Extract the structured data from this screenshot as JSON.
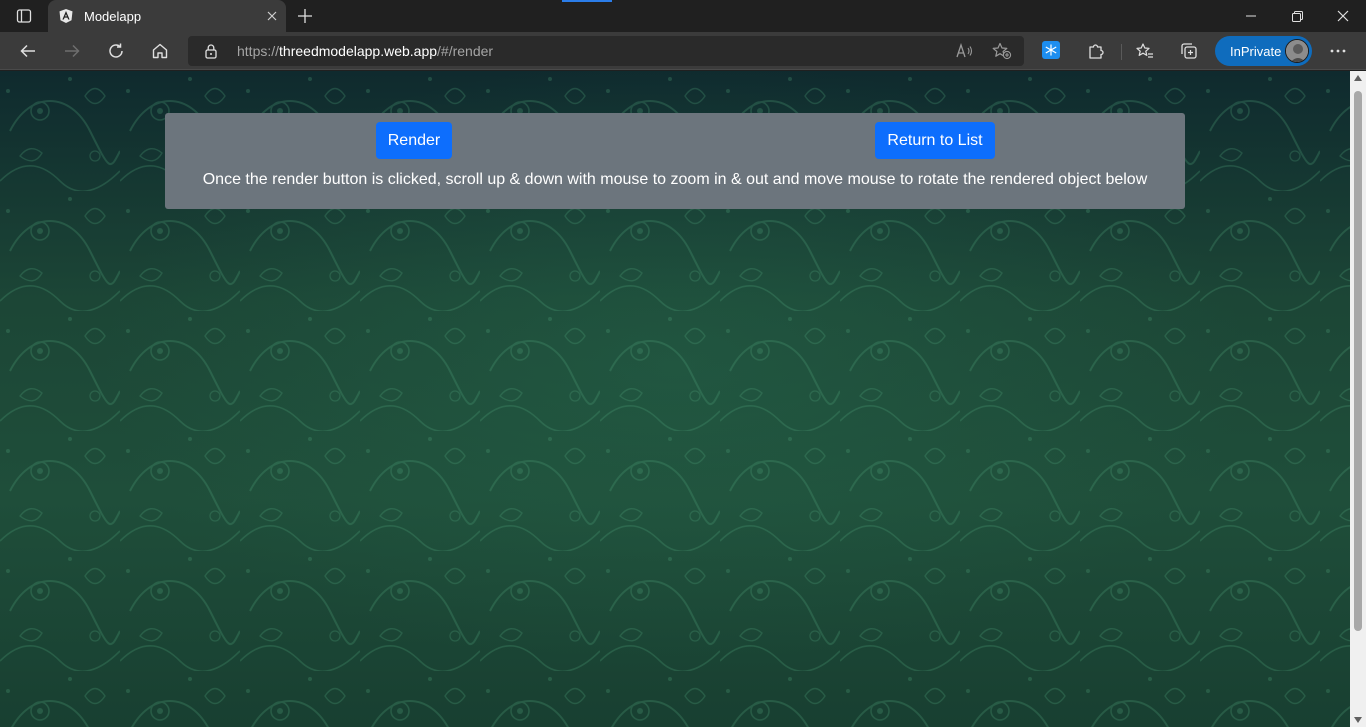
{
  "browser": {
    "tab": {
      "title": "Modelapp",
      "favicon": "angular-icon"
    },
    "address": {
      "scheme": "https://",
      "host": "threedmodelapp.web.app",
      "path": "/#/render"
    },
    "profile": {
      "label": "InPrivate"
    },
    "accent_color": "#0f6cbd"
  },
  "page": {
    "render_button": "Render",
    "return_button": "Return to List",
    "instructions": "Once the render button is clicked, scroll up & down with mouse to zoom in & out and move mouse to rotate the rendered object below",
    "panel_color": "#6c757d",
    "button_color": "#0d6efd"
  }
}
